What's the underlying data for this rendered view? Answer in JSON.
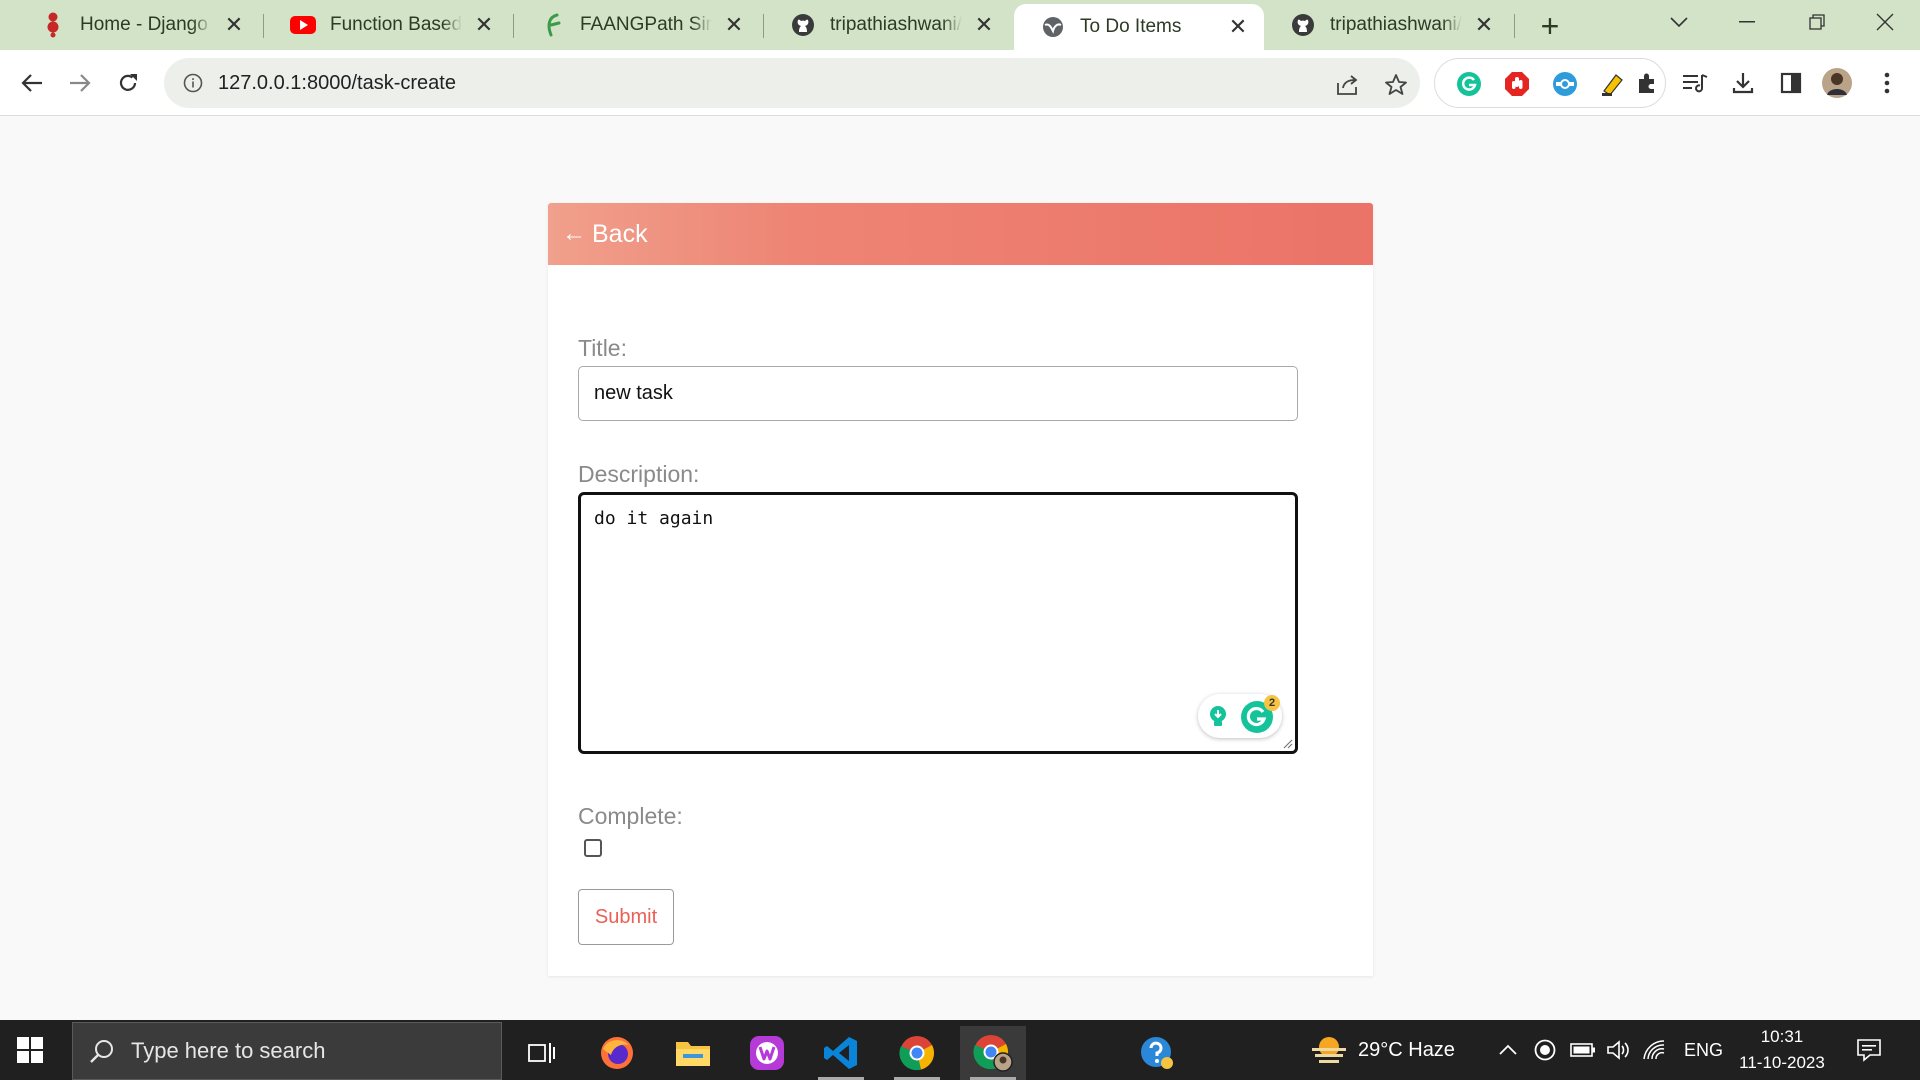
{
  "browser": {
    "tabs": [
      {
        "label": "Home - Django RE",
        "icon": "django-icon",
        "active": false
      },
      {
        "label": "Function Based AP",
        "icon": "youtube-icon",
        "active": false
      },
      {
        "label": "FAANGPath Simple",
        "icon": "faangpath-icon",
        "active": false
      },
      {
        "label": "tripathiashwani/to",
        "icon": "github-icon",
        "active": false
      },
      {
        "label": "To Do Items",
        "icon": "globe-icon",
        "active": true
      },
      {
        "label": "tripathiashwani/de",
        "icon": "github-icon",
        "active": false
      }
    ],
    "url": "127.0.0.1:8000/task-create"
  },
  "page": {
    "back_label": "Back",
    "back_arrow": "←",
    "title_label": "Title:",
    "title_value": "new task",
    "description_label": "Description:",
    "description_value": "do it again",
    "complete_label": "Complete:",
    "complete_checked": false,
    "submit_label": "Submit",
    "grammarly_count": "2",
    "colors": {
      "header_start": "#f0a08c",
      "header_end": "#eb7367",
      "accent": "#eb5f55"
    }
  },
  "taskbar": {
    "search_placeholder": "Type here to search",
    "weather": "29°C  Haze",
    "language": "ENG",
    "time": "10:31",
    "date": "11-10-2023"
  }
}
